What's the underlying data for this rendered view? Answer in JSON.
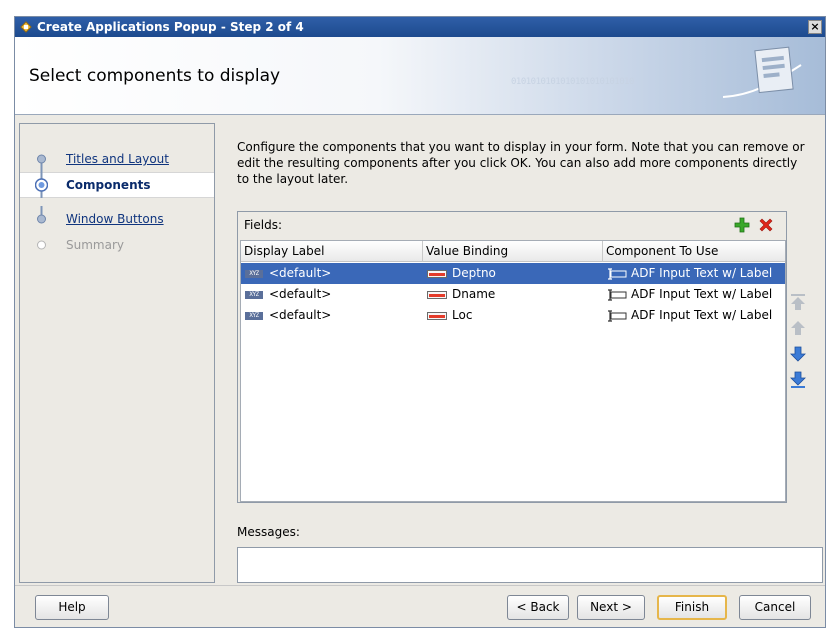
{
  "window": {
    "title": "Create Applications Popup - Step 2 of 4",
    "close_glyph": "×"
  },
  "header": {
    "heading": "Select components to display",
    "decoration_text": "0101010101010101010101010"
  },
  "steps": [
    {
      "label": "Titles and Layout",
      "state": "link"
    },
    {
      "label": "Components",
      "state": "active"
    },
    {
      "label": "Window Buttons",
      "state": "link"
    },
    {
      "label": "Summary",
      "state": "disabled"
    }
  ],
  "main": {
    "description": "Configure the components that you want to display in your form.  Note that you can remove or edit the resulting components after you click OK.  You can also add more components directly to the layout later.",
    "fields_label": "Fields:",
    "columns": [
      "Display Label",
      "Value Binding",
      "Component To Use"
    ],
    "rows": [
      {
        "label": "<default>",
        "binding": "Deptno",
        "component": "ADF Input Text w/ Label",
        "selected": true
      },
      {
        "label": "<default>",
        "binding": "Dname",
        "component": "ADF Input Text w/ Label",
        "selected": false
      },
      {
        "label": "<default>",
        "binding": "Loc",
        "component": "ADF Input Text w/ Label",
        "selected": false
      }
    ],
    "icons": {
      "add": "plus-icon",
      "remove": "delete-icon",
      "move_top": "move-to-top-icon",
      "move_up": "move-up-icon",
      "move_down": "move-down-icon",
      "move_bottom": "move-to-bottom-icon"
    },
    "messages_label": "Messages:",
    "messages_value": ""
  },
  "buttons": {
    "help": "Help",
    "back": "< Back",
    "next": "Next >",
    "finish": "Finish",
    "cancel": "Cancel"
  },
  "colors": {
    "selection": "#3a68b8",
    "titlebar": "#2f5fa8",
    "add_icon": "#3aa82a",
    "delete_icon": "#e0261a",
    "reorder_enabled": "#3b7bd6",
    "reorder_disabled": "#b9bfc6"
  }
}
